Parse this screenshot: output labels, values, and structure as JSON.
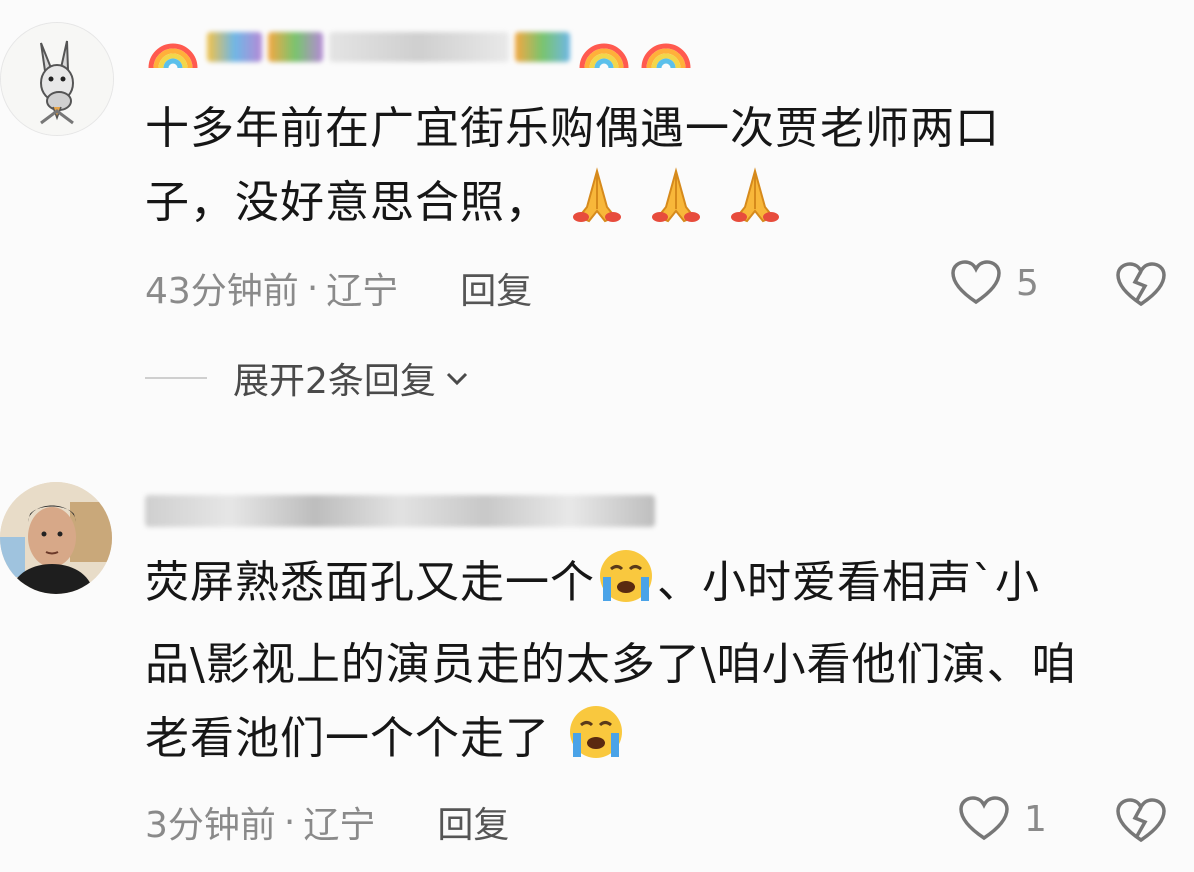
{
  "comments": [
    {
      "content_lines": [
        "十多年前在广宜街乐购偶遇一次贾老师两口",
        "子，没好意思合照，"
      ],
      "time": "43分钟前",
      "separator": "·",
      "location": "辽宁",
      "reply_label": "回复",
      "likes": "5",
      "trailing_emoji": "folded-hands-icon",
      "expand_label": "展开2条回复"
    },
    {
      "content_lines": [
        "荧屏熟悉面孔又走一个",
        "、小时爱看相声`小",
        "品\\影视上的演员走的太多了\\咱小看他们演、咱",
        "老看池们一个个走了"
      ],
      "time": "3分钟前",
      "separator": "·",
      "location": "辽宁",
      "reply_label": "回复",
      "likes": "1",
      "trailing_emoji": "crying-face-icon"
    }
  ],
  "colors": {
    "background": "#fbfbfb",
    "text": "#161616",
    "meta": "#8a8a8a"
  }
}
